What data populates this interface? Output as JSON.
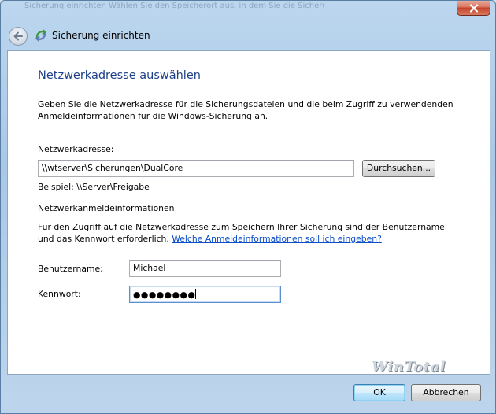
{
  "window": {
    "ghost_title": "Sicherung einrichten",
    "ghost_text": "Wählen Sie den Speicherort aus, in dem Sie die Sicherung speichern möchten"
  },
  "nav": {
    "title": "Sicherung einrichten"
  },
  "main": {
    "heading": "Netzwerkadresse auswählen",
    "intro": "Geben Sie die Netzwerkadresse für die Sicherungsdateien und die beim Zugriff zu verwendenden Anmeldeinformationen für die Windows-Sicherung an.",
    "network_label": "Netzwerkadresse:",
    "network_value": "\\\\wtserver\\Sicherungen\\DualCore",
    "browse_label": "Durchsuchen...",
    "example": "Beispiel: \\\\Server\\Freigabe",
    "cred_heading": "Netzwerkanmeldeinformationen",
    "cred_text": "Für den Zugriff auf die Netzwerkadresse zum Speichern Ihrer Sicherung sind der Benutzername und das Kennwort erforderlich.",
    "cred_link": "Welche Anmeldeinformationen soll ich eingeben?",
    "user_label": "Benutzername:",
    "user_value": "Michael",
    "pass_label": "Kennwort:",
    "pass_value": "●●●●●●●●"
  },
  "watermark": "WinTotal",
  "footer": {
    "ok_label": "OK",
    "cancel_label": "Abbrechen"
  },
  "icons": {
    "close": "close-icon",
    "back": "back-arrow-icon",
    "app": "backup-icon"
  }
}
